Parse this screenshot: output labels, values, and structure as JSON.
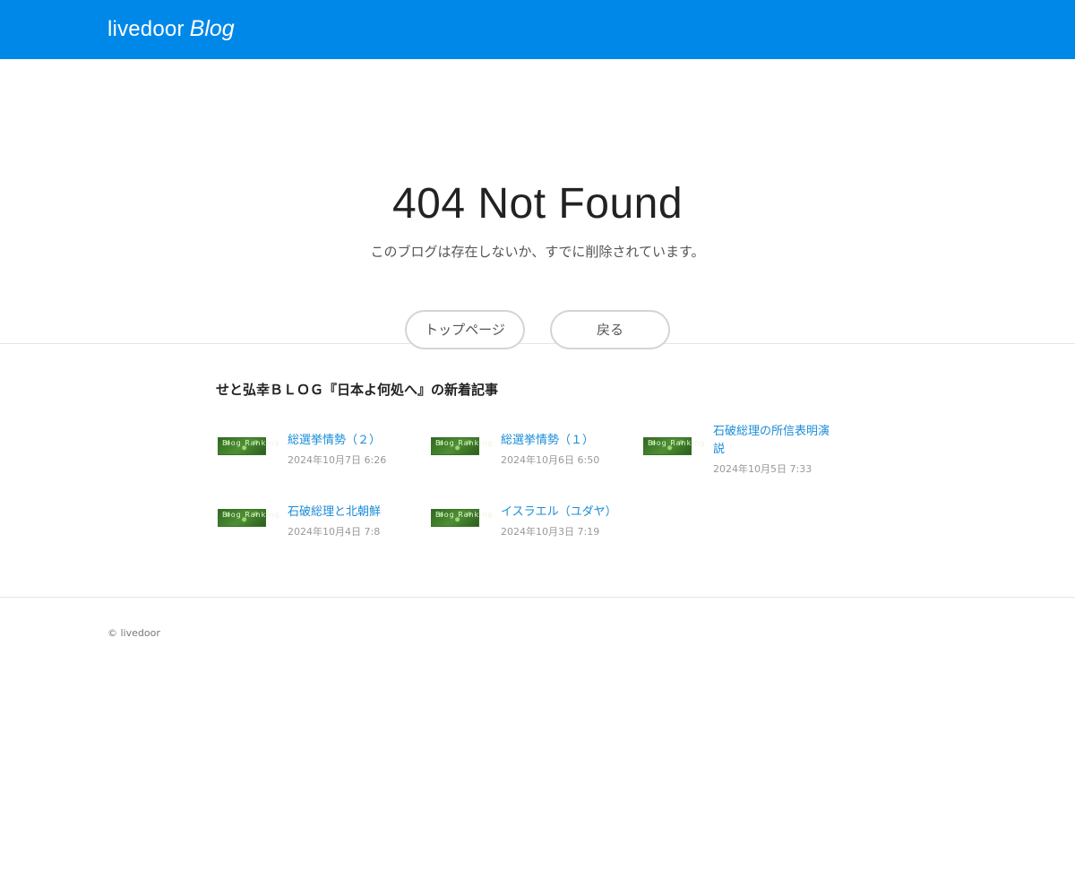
{
  "header": {
    "logo_main": "livedoor",
    "logo_blog": "Blog"
  },
  "error": {
    "title": "404 Not Found",
    "message": "このブログは存在しないか、すでに削除されています。",
    "top_button": "トップページ",
    "back_button": "戻る"
  },
  "recent": {
    "heading": "せと弘幸ＢＬＯＧ『日本よ何処へ』の新着記事",
    "thumb_text": "Blog Ranking",
    "articles": [
      {
        "title": "総選挙情勢（２）",
        "date": "2024年10月7日 6:26"
      },
      {
        "title": "総選挙情勢（１）",
        "date": "2024年10月6日 6:50"
      },
      {
        "title": "石破総理の所信表明演説",
        "date": "2024年10月5日 7:33"
      },
      {
        "title": "石破総理と北朝鮮",
        "date": "2024年10月4日 7:8"
      },
      {
        "title": "イスラエル（ユダヤ）",
        "date": "2024年10月3日 7:19"
      }
    ]
  },
  "footer": {
    "copyright": "© livedoor"
  },
  "colors": {
    "header_bg": "#0088e8",
    "link": "#1a8cd8",
    "date": "#999999",
    "divider": "#e5e5e5"
  }
}
